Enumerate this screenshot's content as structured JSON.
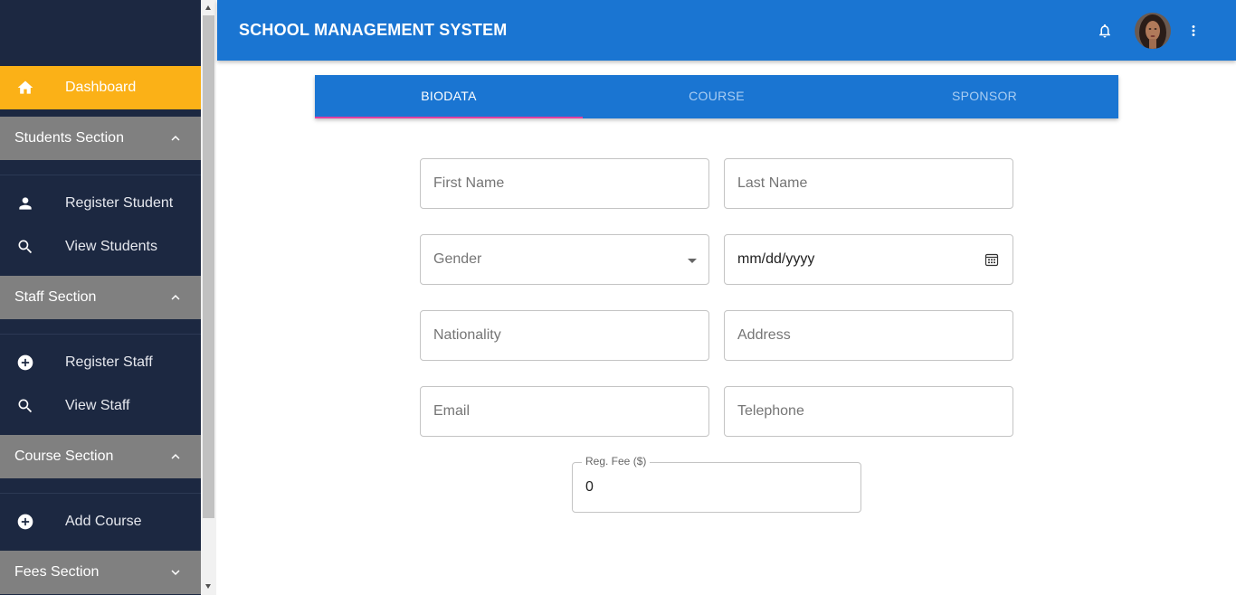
{
  "app": {
    "title": "SCHOOL MANAGEMENT SYSTEM"
  },
  "topbar": {
    "notification_icon": "bell-icon",
    "avatar_icon": "user-avatar",
    "menu_icon": "more-vert-icon"
  },
  "sidebar": {
    "dashboard": {
      "label": "Dashboard",
      "icon": "home-icon"
    },
    "sections": [
      {
        "label": "Students Section",
        "expanded": true,
        "items": [
          {
            "label": "Register Student",
            "icon": "person-icon"
          },
          {
            "label": "View Students",
            "icon": "search-icon"
          }
        ]
      },
      {
        "label": "Staff Section",
        "expanded": true,
        "items": [
          {
            "label": "Register Staff",
            "icon": "add-circle-icon"
          },
          {
            "label": "View Staff",
            "icon": "search-icon"
          }
        ]
      },
      {
        "label": "Course Section",
        "expanded": true,
        "items": [
          {
            "label": "Add Course",
            "icon": "add-circle-icon"
          }
        ]
      },
      {
        "label": "Fees Section",
        "expanded": false,
        "items": []
      }
    ]
  },
  "tabs": [
    {
      "label": "BIODATA",
      "active": true
    },
    {
      "label": "COURSE",
      "active": false
    },
    {
      "label": "SPONSOR",
      "active": false
    }
  ],
  "form": {
    "first_name": {
      "placeholder": "First Name"
    },
    "last_name": {
      "placeholder": "Last Name"
    },
    "gender": {
      "placeholder": "Gender"
    },
    "dob": {
      "placeholder": "mm/dd/yyyy"
    },
    "nationality": {
      "placeholder": "Nationality"
    },
    "address": {
      "placeholder": "Address"
    },
    "email": {
      "placeholder": "Email"
    },
    "telephone": {
      "placeholder": "Telephone"
    },
    "reg_fee": {
      "label": "Reg. Fee ($)",
      "value": "0"
    }
  },
  "colors": {
    "sidebar_bg": "#1c2841",
    "accent": "#fbb117",
    "primary": "#1a75d2",
    "section_bg": "#808080",
    "tab_indicator": "#e040a0"
  }
}
